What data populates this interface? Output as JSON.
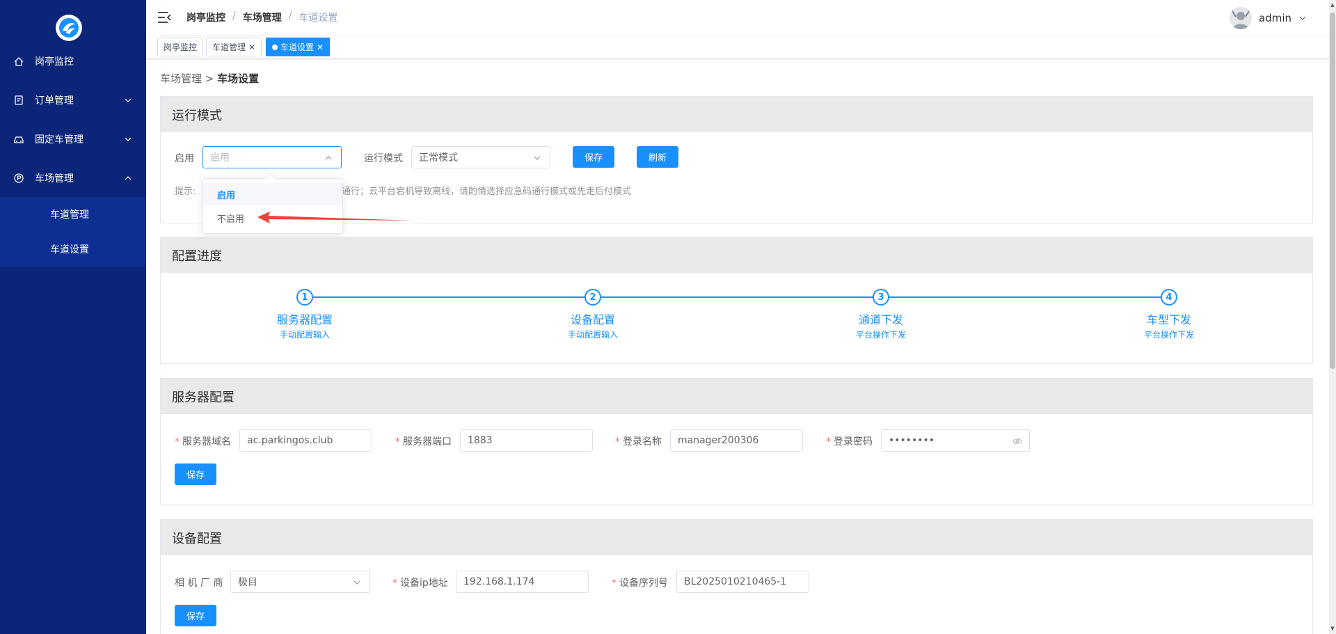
{
  "sidebar": {
    "items": [
      {
        "label": "岗亭监控",
        "icon": "kiosk-monitor-icon"
      },
      {
        "label": "订单管理",
        "icon": "order-icon"
      },
      {
        "label": "固定车管理",
        "icon": "car-icon"
      },
      {
        "label": "车场管理",
        "icon": "parking-icon"
      }
    ],
    "sub_items": [
      {
        "label": "车道管理"
      },
      {
        "label": "车道设置"
      }
    ]
  },
  "header": {
    "breadcrumb": [
      "岗亭监控",
      "车场管理",
      "车道设置"
    ],
    "user": "admin"
  },
  "tags": [
    {
      "label": "岗亭监控"
    },
    {
      "label": "车道管理"
    },
    {
      "label": "车道设置"
    }
  ],
  "page_crumb": {
    "parent": "车场管理 >",
    "current": "车场设置"
  },
  "run_mode": {
    "title": "运行模式",
    "enable_label": "启用",
    "enable_placeholder": "启用",
    "mode_label": "运行模式",
    "mode_value": "正常模式",
    "save": "保存",
    "refresh": "刷新",
    "tip_prefix": "提示:",
    "tip_rest": "通行；云平台宕机导致离线，请酌情选择应急码通行模式或先走后付模式",
    "dropdown_options": [
      "启用",
      "不启用"
    ]
  },
  "progress": {
    "title": "配置进度",
    "steps": [
      {
        "num": "1",
        "title": "服务器配置",
        "desc": "手动配置输入"
      },
      {
        "num": "2",
        "title": "设备配置",
        "desc": "手动配置输入"
      },
      {
        "num": "3",
        "title": "通道下发",
        "desc": "平台操作下发"
      },
      {
        "num": "4",
        "title": "车型下发",
        "desc": "平台操作下发"
      }
    ]
  },
  "server": {
    "title": "服务器配置",
    "domain_label": "服务器域名",
    "domain_value": "ac.parkingos.club",
    "port_label": "服务器端口",
    "port_value": "1883",
    "login_label": "登录名称",
    "login_value": "manager200306",
    "pwd_label": "登录密码",
    "pwd_value": "••••••••",
    "save": "保存"
  },
  "device": {
    "title": "设备配置",
    "vendor_label": "相 机 厂 商",
    "vendor_value": "极目",
    "ip_label": "设备ip地址",
    "ip_value": "192.168.1.174",
    "serial_label": "设备序列号",
    "serial_value": "BL2025010210465-1",
    "save": "保存"
  },
  "colors": {
    "sidebar": "#0b2578",
    "primary": "#1890ff",
    "arrow": "#e8453c"
  }
}
